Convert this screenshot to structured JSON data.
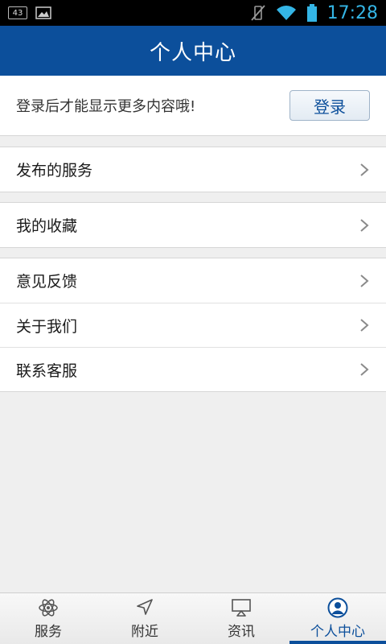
{
  "status_bar": {
    "notification_count": "43",
    "time": "17:28"
  },
  "header": {
    "title": "个人中心"
  },
  "login": {
    "hint": "登录后才能显示更多内容哦!",
    "button_label": "登录"
  },
  "menu": {
    "group1": [
      {
        "label": "发布的服务"
      }
    ],
    "group2": [
      {
        "label": "我的收藏"
      }
    ],
    "group3": [
      {
        "label": "意见反馈"
      },
      {
        "label": "关于我们"
      },
      {
        "label": "联系客服"
      }
    ]
  },
  "bottom_nav": {
    "tabs": [
      {
        "label": "服务",
        "icon": "atom-icon"
      },
      {
        "label": "附近",
        "icon": "navigation-arrow-icon"
      },
      {
        "label": "资讯",
        "icon": "screen-icon"
      },
      {
        "label": "个人中心",
        "icon": "person-icon"
      }
    ],
    "active_index": 3
  },
  "colors": {
    "brand": "#0c4f9b",
    "status_accent": "#34b5e5",
    "background": "#efefef"
  }
}
